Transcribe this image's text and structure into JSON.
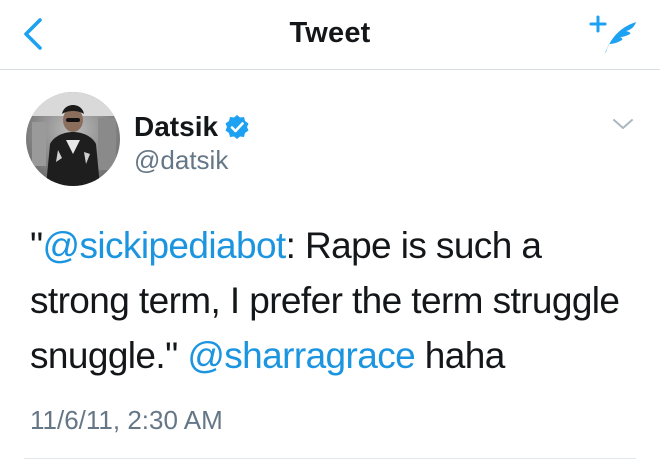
{
  "header": {
    "title": "Tweet",
    "back_icon": "chevron-left-icon",
    "compose_icon": "compose-tweet-icon"
  },
  "tweet": {
    "author": {
      "display_name": "Datsik",
      "handle": "@datsik",
      "verified_icon": "verified-badge-icon"
    },
    "text_parts": {
      "quote_open": "\"",
      "mention_1": "@sickipediabot",
      "body": ": Rape is such a strong term,  I prefer the term struggle snuggle.\" ",
      "mention_2": "@sharragrace",
      "tail": " haha"
    },
    "timestamp": "11/6/11, 2:30 AM"
  },
  "colors": {
    "accent": "#1b95e0",
    "secondary_text": "#657786",
    "primary_text": "#14171a",
    "divider": "#e1e8ed"
  }
}
